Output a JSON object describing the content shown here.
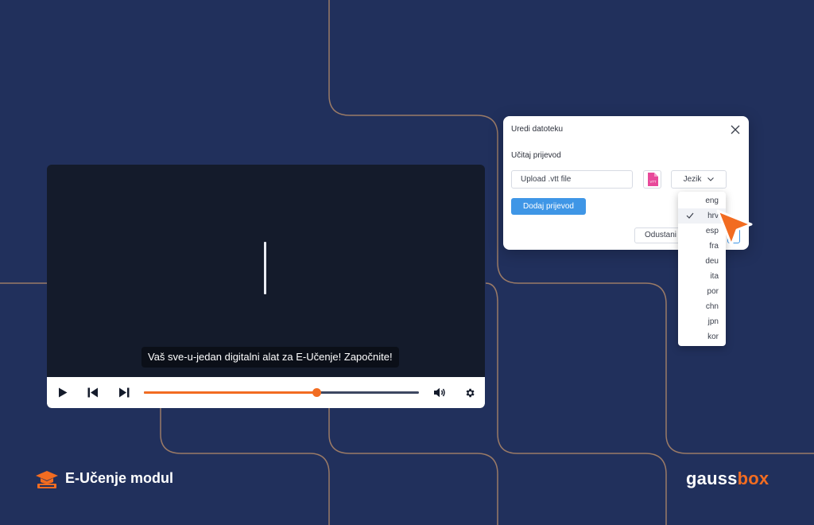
{
  "colors": {
    "background": "#21305c",
    "line": "#9a7a66",
    "accent": "#f26c21",
    "primary_button": "#3f96e6",
    "player_bg": "#141b2b"
  },
  "player": {
    "caption": "Vaš sve-u-jedan digitalni alat za E-Učenje! Započnite!",
    "progress": 0.63,
    "icons": {
      "play": "play-icon",
      "prev": "skip-back-icon",
      "next": "skip-forward-icon",
      "volume": "volume-icon",
      "settings": "gear-icon"
    }
  },
  "dialog": {
    "title": "Uredi datoteku",
    "section_label": "Učitaj prijevod",
    "upload_placeholder": "Upload .vtt file",
    "vtt_badge": "VTT",
    "language_select": "Jezik",
    "add_button": "Dodaj prijevod",
    "cancel_button": "Odustani"
  },
  "languages": {
    "selected": "hrv",
    "options": [
      "eng",
      "hrv",
      "esp",
      "fra",
      "deu",
      "ita",
      "por",
      "chn",
      "jpn",
      "kor"
    ]
  },
  "branding": {
    "module_title": "E-Učenje modul",
    "brand_part1": "gauss",
    "brand_part2": "box"
  }
}
